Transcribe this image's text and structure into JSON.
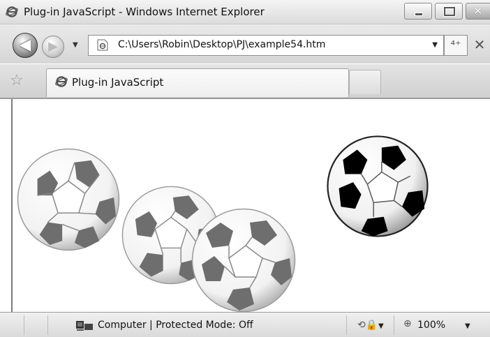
{
  "window": {
    "title": "Plug-in JavaScript - Windows Internet Explorer",
    "minimize_icon": "minimize-icon",
    "maximize_icon": "maximize-icon",
    "close_glyph": "✕"
  },
  "navigation": {
    "back_glyph": "◀",
    "forward_glyph": "▶",
    "dropdown_glyph": "▼",
    "address": "C:\\Users\\Robin\\Desktop\\PJ\\example54.htm",
    "refresh_glyph": "⁴⁺",
    "stop_glyph": "✕"
  },
  "tabs": {
    "favorites_glyph": "☆",
    "active_tab_title": "Plug-in JavaScript"
  },
  "content": {
    "balls": [
      {
        "name": "faded-ball-1",
        "style": "faded"
      },
      {
        "name": "faded-ball-2",
        "style": "faded"
      },
      {
        "name": "faded-ball-3",
        "style": "faded"
      },
      {
        "name": "solid-ball",
        "style": "solid"
      }
    ],
    "colors": {
      "faded_patch": "#6e6e6e",
      "solid_patch": "#000000",
      "ball_white": "#ffffff",
      "seam": "#777777"
    }
  },
  "statusbar": {
    "zone_text": "Computer | Protected Mode: Off",
    "dropdown_glyph": "▼",
    "zoom": "100%",
    "zoom_icon": "magnifier-icon",
    "popup_icon": "security-icon"
  }
}
